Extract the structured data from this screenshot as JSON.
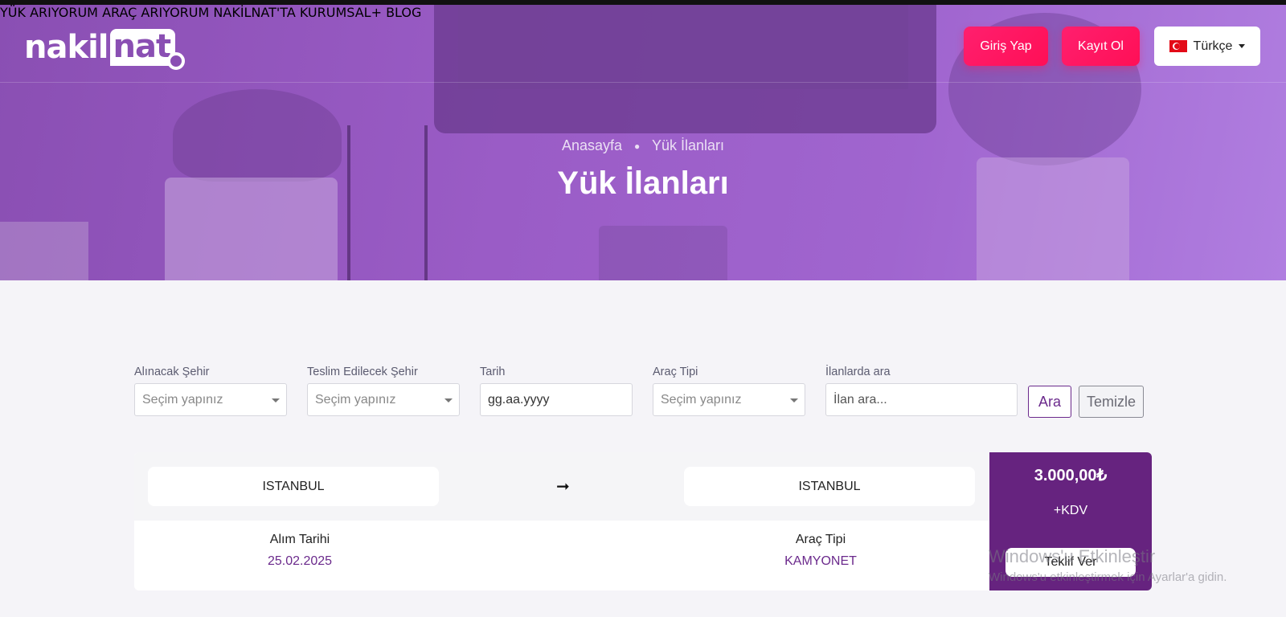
{
  "brand": {
    "logo_part1": "nakil",
    "logo_part2": "nat"
  },
  "nav": {
    "items": [
      "YÜK ARIYORUM",
      "ARAÇ ARIYORUM",
      "NAKİLNAT'TA KURUMSAL+",
      "BLOG"
    ],
    "login": "Giriş Yap",
    "register": "Kayıt Ol",
    "language": "Türkçe"
  },
  "hero": {
    "breadcrumb_home": "Anasayfa",
    "breadcrumb_current": "Yük İlanları",
    "title": "Yük İlanları"
  },
  "filters": {
    "pickup_label": "Alınacak Şehir",
    "pickup_value": "Seçim yapınız",
    "delivery_label": "Teslim Edilecek Şehir",
    "delivery_value": "Seçim yapınız",
    "date_label": "Tarih",
    "date_value": "gg.aa.yyyy",
    "vehicle_label": "Araç Tipi",
    "vehicle_value": "Seçim yapınız",
    "search_label": "İlanlarda ara",
    "search_placeholder": "İlan ara...",
    "search_button": "Ara",
    "clear_button": "Temizle"
  },
  "listing": {
    "from_city": "ISTANBUL",
    "arrow": "➞",
    "to_city": "ISTANBUL",
    "pickup_date_label": "Alım Tarihi",
    "pickup_date": "25.02.2025",
    "vehicle_type_label": "Araç Tipi",
    "vehicle_type": "KAMYONET",
    "price": "3.000,00₺",
    "tax_note": "+KDV",
    "offer_button": "Teklif Ver"
  },
  "watermark": {
    "line1": "Windows'u Etkinleştir",
    "line2": "Windows'u etkinleştirmek için Ayarlar'a gidin."
  },
  "colors": {
    "hero_purple": "#9a5cc6",
    "accent_pink": "#ff1f6e",
    "price_panel": "#66237f",
    "value_purple": "#6b2a8c"
  }
}
